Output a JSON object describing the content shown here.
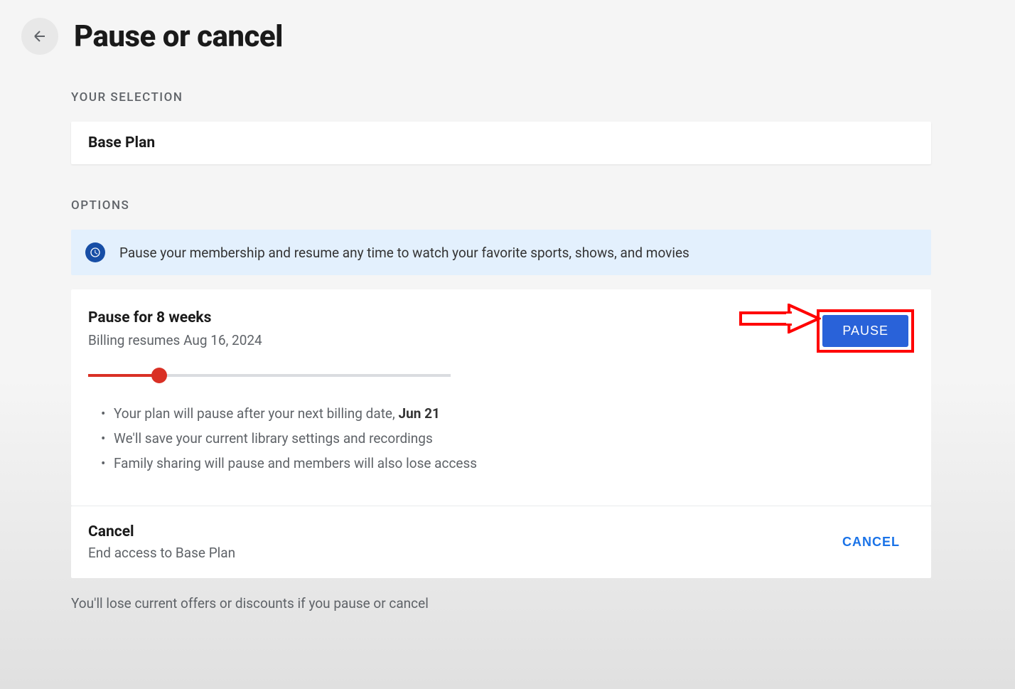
{
  "header": {
    "title": "Pause or cancel"
  },
  "selection": {
    "label": "YOUR SELECTION",
    "plan": "Base Plan"
  },
  "options": {
    "label": "OPTIONS",
    "banner": "Pause your membership and resume any time to watch your favorite sports, shows, and movies"
  },
  "pause": {
    "title": "Pause for 8 weeks",
    "subtitle": "Billing resumes Aug 16, 2024",
    "button": "PAUSE",
    "bullets": {
      "b1_prefix": "Your plan will pause after your next billing date, ",
      "b1_bold": "Jun 21",
      "b2": "We'll save your current library settings and recordings",
      "b3": "Family sharing will pause and members will also lose access"
    }
  },
  "cancel": {
    "title": "Cancel",
    "subtitle": "End access to Base Plan",
    "button": "CANCEL"
  },
  "footer": "You'll lose current offers or discounts if you pause or cancel"
}
